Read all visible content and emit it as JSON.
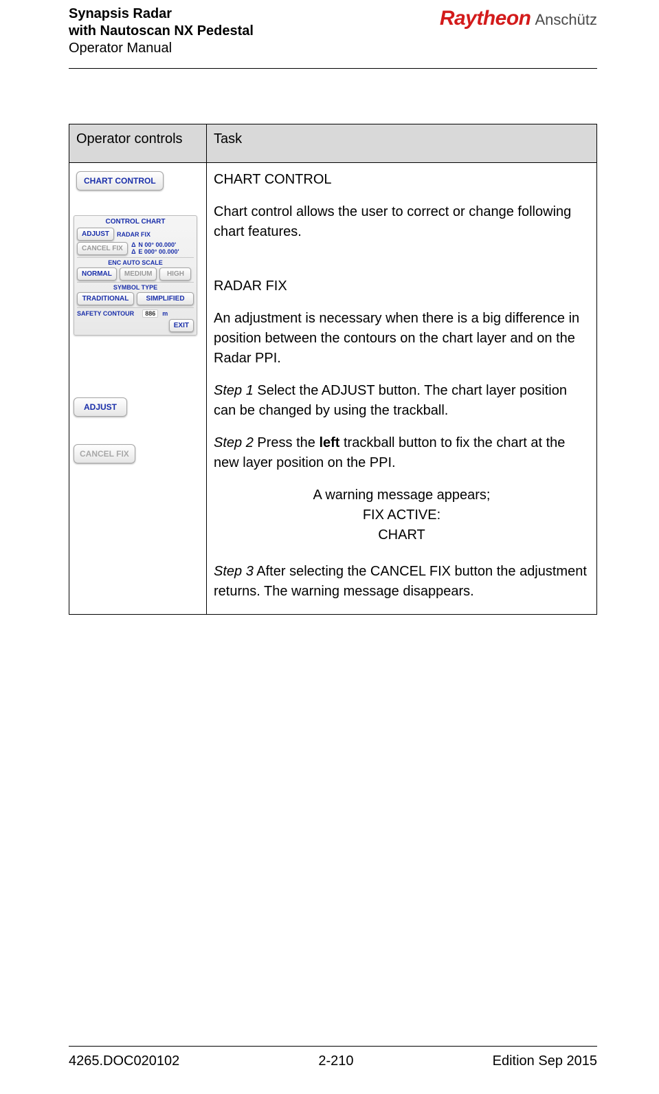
{
  "header": {
    "title_line1": "Synapsis Radar",
    "title_line2": "with Nautoscan NX Pedestal",
    "title_line3": "Operator Manual",
    "brand_primary": "Raytheon",
    "brand_secondary": "Anschütz"
  },
  "table": {
    "col1_header": "Operator controls",
    "col2_header": "Task"
  },
  "controls": {
    "chart_control_btn": "CHART CONTROL",
    "panel": {
      "title": "CONTROL CHART",
      "adjust": "ADJUST",
      "radar_fix": "RADAR FIX",
      "cancel_fix": "CANCEL FIX",
      "lat": "N 00° 00.000'",
      "lon": "E 000° 00.000'",
      "enc_auto_scale": "ENC AUTO SCALE",
      "normal": "NORMAL",
      "medium": "MEDIUM",
      "high": "HIGH",
      "symbol_type": "SYMBOL TYPE",
      "traditional": "TRADITIONAL",
      "simplified": "SIMPLIFIED",
      "safety_contour": "SAFETY CONTOUR",
      "safety_value": "886",
      "safety_unit": "m",
      "exit": "EXIT"
    },
    "adjust_btn": "ADJUST",
    "cancel_fix_btn": "CANCEL FIX"
  },
  "task": {
    "h1": "CHART CONTROL",
    "p1": "Chart control allows the user to correct or change following chart features.",
    "h2": "RADAR FIX",
    "p2": "An adjustment is necessary when there is a big difference in position between the contours on the chart layer and on the Radar PPI.",
    "step1_prefix": "Step 1",
    "step1_text": " Select the ADJUST button. The chart layer position can be changed by using the trackball.",
    "step2_prefix": "Step 2",
    "step2_text_a": " Press the ",
    "step2_bold": "left",
    "step2_text_b": " trackball button to fix the chart at the new layer position on the PPI.",
    "warn1": "A warning message appears;",
    "warn2": "FIX ACTIVE:",
    "warn3": "CHART",
    "step3_prefix": "Step 3",
    "step3_text": " After selecting the CANCEL FIX button the adjustment returns. The warning message disappears."
  },
  "footer": {
    "doc_no": "4265.DOC020102",
    "page": "2-210",
    "edition": "Edition Sep 2015"
  }
}
